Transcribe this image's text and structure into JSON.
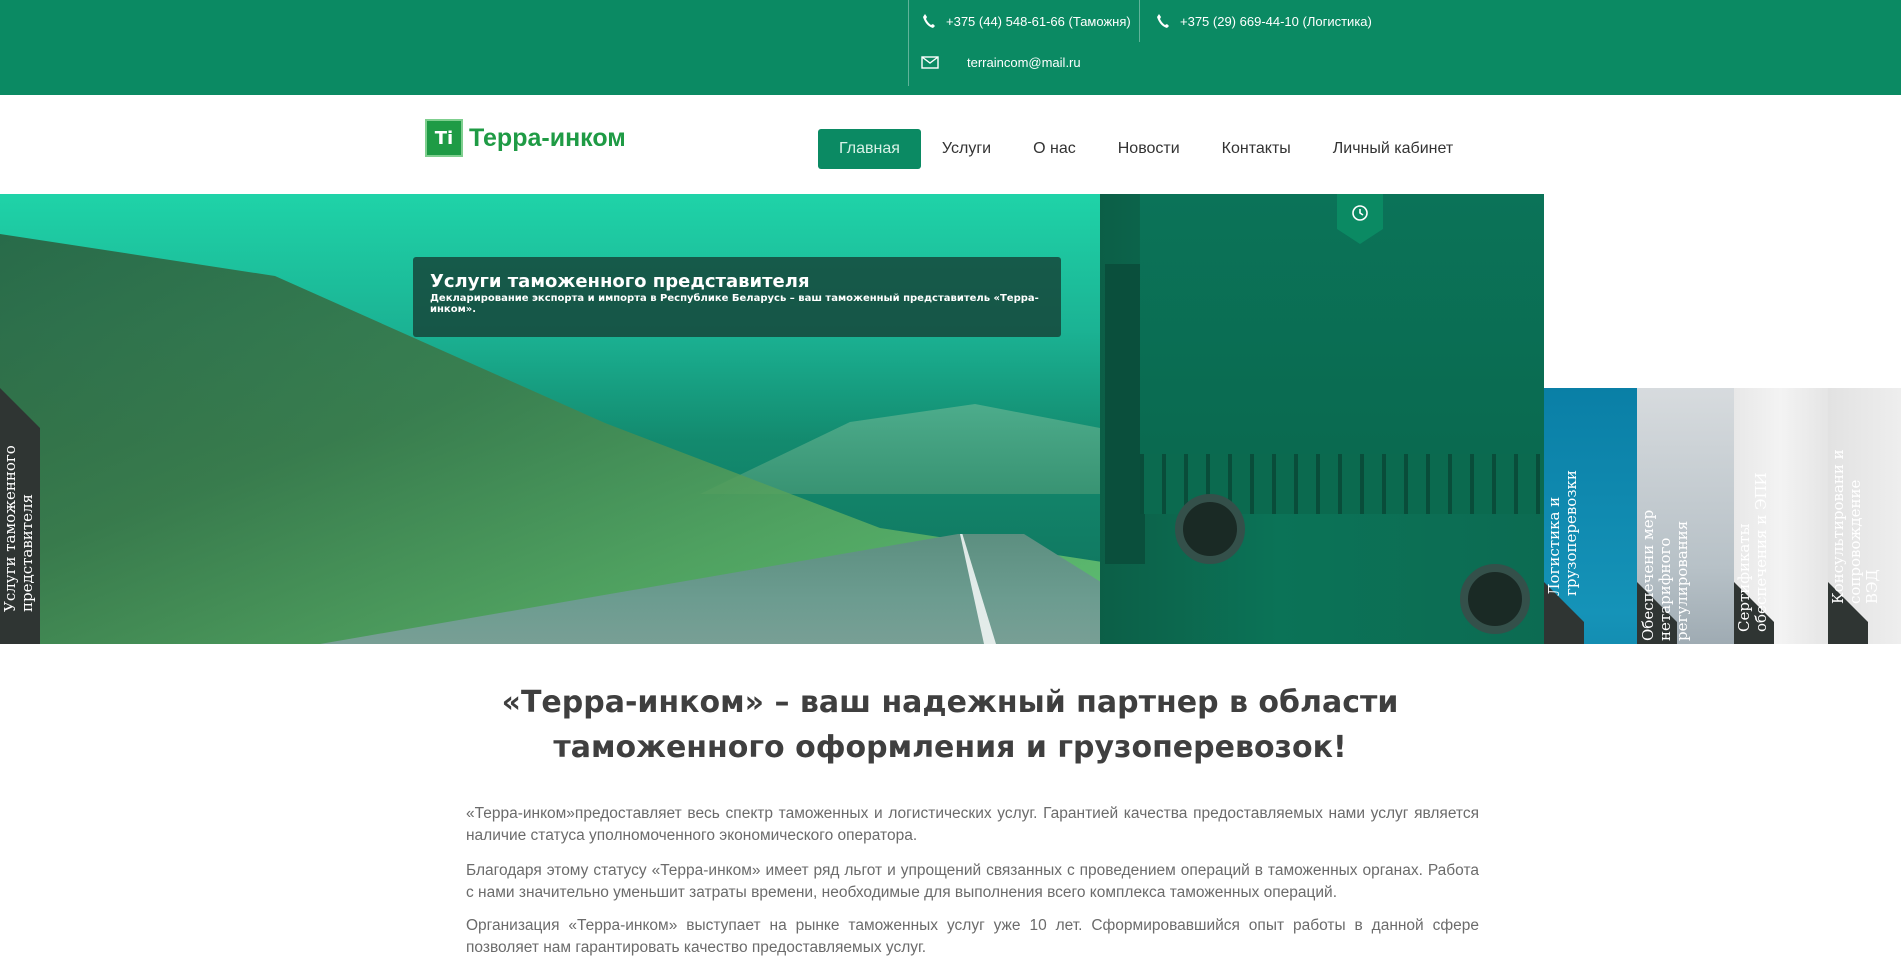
{
  "topbar": {
    "phone1": "+375 (44) 548-61-66 (Таможня)",
    "phone2": "+375 (29) 669-44-10 (Логистика)",
    "email": "terraincom@mail.ru",
    "phone_icon": "phone-icon",
    "mail_icon": "envelope-icon",
    "bg_color": "#0b8a63"
  },
  "header": {
    "logo_mark": "Ti",
    "logo_text": "Терра-инком",
    "nav": [
      "Главная",
      "Услуги",
      "О нас",
      "Новости",
      "Контакты",
      "Личный кабинет"
    ],
    "active_nav": "Главная"
  },
  "hero": {
    "title": "Услуги таможенного представителя",
    "subtitle": "Декларирование экспорта и импорта в Республике Беларусь – ваш таможенный представитель «Терра-инком».",
    "left_tab": "Услуги таможенного представителя",
    "panels": [
      "Логистика и грузоперевозки",
      "Обеспечени мер нетарифного регулирования",
      "Сертификаты обеспечения и ЭПИ",
      "Консультировани и сопровождение ВЭД"
    ],
    "badge_icon": "clock-icon"
  },
  "content": {
    "headline": "«Терра-инком» – ваш надежный партнер в области таможенного оформления и грузоперевозок!",
    "paragraphs": [
      "«Терра-инком»предоставляет весь спектр таможенных и логистических услуг. Гарантией качества предоставляемых нами услуг является наличие статуса уполномоченного экономического оператора.",
      "Благодаря этому статусу «Терра-инком» имеет ряд льгот и упрощений связанных с проведением операций в таможенных органах. Работа с нами значительно уменьшит затраты времени, необходимые для выполнения всего комплекса таможенных операций.",
      "Организация «Терра-инком» выступает на рынке таможенных услуг уже 10 лет. Сформировавшийся опыт работы в данной сфере позволяет нам гарантировать качество предоставляемых услуг."
    ]
  }
}
